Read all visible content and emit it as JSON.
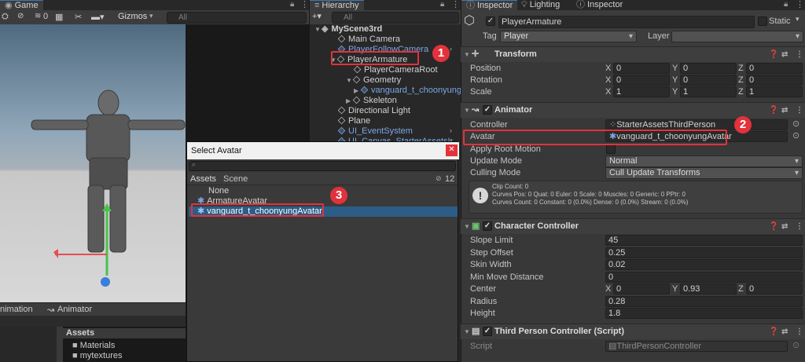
{
  "game_panel": {
    "tab_label": "Game",
    "gizmos_label": "Gizmos",
    "search_placeholder": "All",
    "hidden_count": "0",
    "persp_label": "< Persp",
    "bottom_tabs": [
      "nimation",
      "Animator"
    ],
    "assets_header": "Assets",
    "asset_folders": [
      "Materials",
      "mytextures"
    ]
  },
  "hierarchy": {
    "tab_label": "Hierarchy",
    "search_placeholder": "All",
    "scene_name": "MyScene3rd",
    "items": [
      {
        "label": "Main Camera",
        "blue": false
      },
      {
        "label": "PlayerFollowCamera",
        "blue": true
      },
      {
        "label": "PlayerArmature",
        "blue": false
      },
      {
        "label": "PlayerCameraRoot",
        "blue": false
      },
      {
        "label": "Geometry",
        "blue": false
      },
      {
        "label": "vanguard_t_choonyung",
        "blue": true
      },
      {
        "label": "Skeleton",
        "blue": false
      },
      {
        "label": "Directional Light",
        "blue": false
      },
      {
        "label": "Plane",
        "blue": false
      },
      {
        "label": "UI_EventSystem",
        "blue": true
      },
      {
        "label": "UI_Canvas_StarterAssetsIn",
        "blue": true
      }
    ]
  },
  "inspector": {
    "tabs": [
      "Inspector",
      "Lighting",
      "Inspector"
    ],
    "object_name": "PlayerArmature",
    "static_label": "Static",
    "tag_label": "Tag",
    "tag_value": "Player",
    "layer_label": "Layer",
    "layer_value": "",
    "transform": {
      "title": "Transform",
      "rows": [
        {
          "label": "Position",
          "x": "0",
          "y": "0",
          "z": "0"
        },
        {
          "label": "Rotation",
          "x": "0",
          "y": "0",
          "z": "0"
        },
        {
          "label": "Scale",
          "x": "1",
          "y": "1",
          "z": "1"
        }
      ]
    },
    "animator": {
      "title": "Animator",
      "controller_label": "Controller",
      "controller_value": "StarterAssetsThirdPerson",
      "avatar_label": "Avatar",
      "avatar_value": "vanguard_t_choonyungAvatar",
      "apply_root_motion_label": "Apply Root Motion",
      "update_mode_label": "Update Mode",
      "update_mode_value": "Normal",
      "culling_mode_label": "Culling Mode",
      "culling_mode_value": "Cull Update Transforms",
      "info_lines": [
        "Clip Count: 0",
        "Curves Pos: 0 Quat: 0 Euler: 0 Scale: 0 Muscles: 0 Generic: 0 PPtr: 0",
        "Curves Count: 0 Constant: 0 (0.0%) Dense: 0 (0.0%) Stream: 0 (0.0%)"
      ]
    },
    "character_controller": {
      "title": "Character Controller",
      "rows": [
        {
          "label": "Slope Limit",
          "value": "45"
        },
        {
          "label": "Step Offset",
          "value": "0.25"
        },
        {
          "label": "Skin Width",
          "value": "0.02"
        },
        {
          "label": "Min Move Distance",
          "value": "0"
        }
      ],
      "center_label": "Center",
      "center": {
        "x": "0",
        "y": "0.93",
        "z": "0"
      },
      "radius_label": "Radius",
      "radius_value": "0.28",
      "height_label": "Height",
      "height_value": "1.8"
    },
    "third_person": {
      "title": "Third Person Controller (Script)",
      "script_label": "Script",
      "script_value": "ThirdPersonController"
    }
  },
  "select_avatar_popup": {
    "title": "Select Avatar",
    "tabs": [
      "Assets",
      "Scene"
    ],
    "count": "12",
    "items": [
      "None",
      "ArmatureAvatar",
      "vanguard_t_choonyungAvatar"
    ]
  },
  "callouts": [
    "1",
    "2",
    "3"
  ]
}
